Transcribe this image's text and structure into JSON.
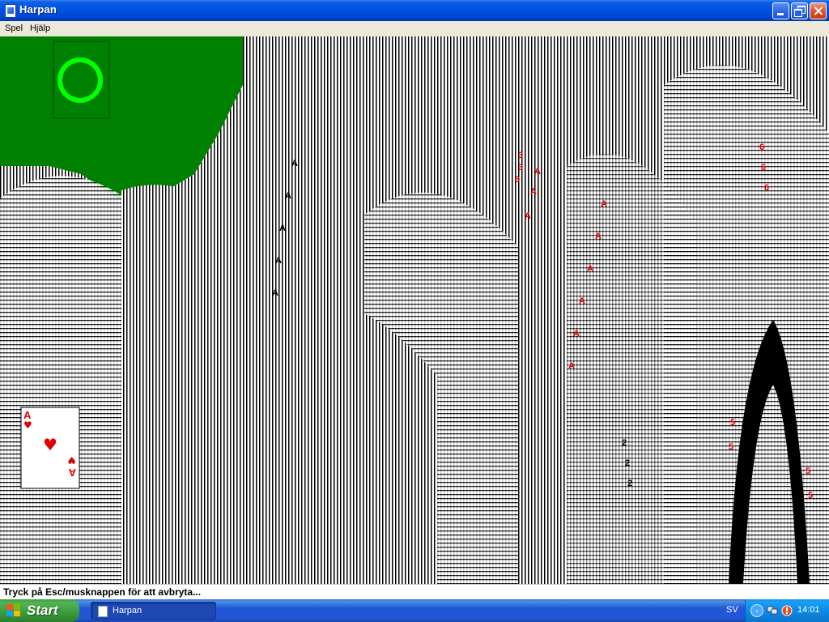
{
  "window": {
    "title": "Harpan"
  },
  "menu": {
    "items": [
      "Spel",
      "Hjälp"
    ]
  },
  "game": {
    "felt_color": "#008000",
    "foundation_marker_color": "#00ff00",
    "ace_card": {
      "rank": "A",
      "suit": "hearts",
      "suit_glyph": "♥"
    },
    "card_ranks_visible": [
      "A",
      "2",
      "3",
      "5",
      "6"
    ]
  },
  "statusbar": {
    "text": "Tryck på Esc/musknappen för att avbryta..."
  },
  "taskbar": {
    "start_label": "Start",
    "task_label": "Harpan",
    "language": "SV",
    "clock": "14:01"
  }
}
